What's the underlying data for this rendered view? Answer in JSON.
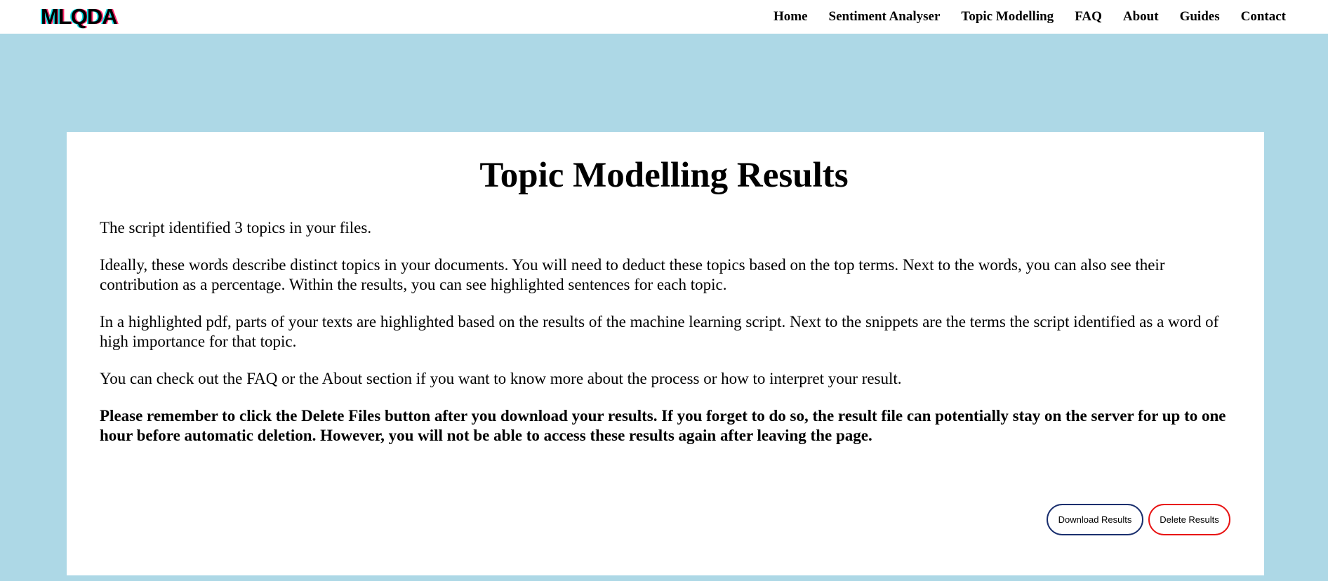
{
  "header": {
    "logo_text": "MLQDA",
    "nav": [
      {
        "label": "Home"
      },
      {
        "label": "Sentiment Analyser"
      },
      {
        "label": "Topic Modelling"
      },
      {
        "label": "FAQ"
      },
      {
        "label": "About"
      },
      {
        "label": "Guides"
      },
      {
        "label": "Contact"
      }
    ]
  },
  "main": {
    "title": "Topic Modelling Results",
    "paragraphs": [
      "The script identified 3 topics in your files.",
      "Ideally, these words describe distinct topics in your documents. You will need to deduct these topics based on the top terms. Next to the words, you can also see their contribution as a percentage. Within the results, you can see highlighted sentences for each topic.",
      "In a highlighted pdf, parts of your texts are highlighted based on the results of the machine learning script. Next to the snippets are the terms the script identified as a word of high importance for that topic.",
      "You can check out the FAQ or the About section if you want to know more about the process or how to interpret your result."
    ],
    "warning": "Please remember to click the Delete Files button after you download your results. If you forget to do so, the result file can potentially stay on the server for up to one hour before automatic deletion. However, you will not be able to access these results again after leaving the page.",
    "download_label": "Download Results",
    "delete_label": "Delete Results"
  },
  "colors": {
    "page_background": "#add8e6",
    "card_background": "#ffffff",
    "download_border": "#1a2f6e",
    "delete_border": "#e81414"
  }
}
